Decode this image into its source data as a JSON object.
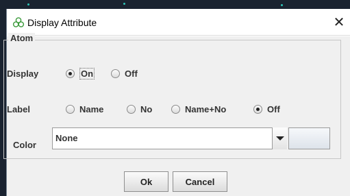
{
  "window": {
    "title": "Display Attribute",
    "close_glyph": "✕"
  },
  "group": {
    "label": "Atom"
  },
  "display_row": {
    "label": "Display",
    "options": [
      {
        "label": "On",
        "checked": true
      },
      {
        "label": "Off",
        "checked": false
      }
    ]
  },
  "label_row": {
    "label": "Label",
    "options": [
      {
        "label": "Name",
        "checked": false
      },
      {
        "label": "No",
        "checked": false
      },
      {
        "label": "Name+No",
        "checked": false
      },
      {
        "label": "Off",
        "checked": true
      }
    ]
  },
  "color_row": {
    "label": "Color",
    "selected": "None"
  },
  "buttons": {
    "ok": "Ok",
    "cancel": "Cancel"
  },
  "icons": {
    "title_icon": "atom-clover-icon",
    "dropdown": "chevron-down-icon"
  },
  "colors": {
    "accent_green": "#3a9a3a",
    "dialog_bg": "#f0f0f0"
  }
}
